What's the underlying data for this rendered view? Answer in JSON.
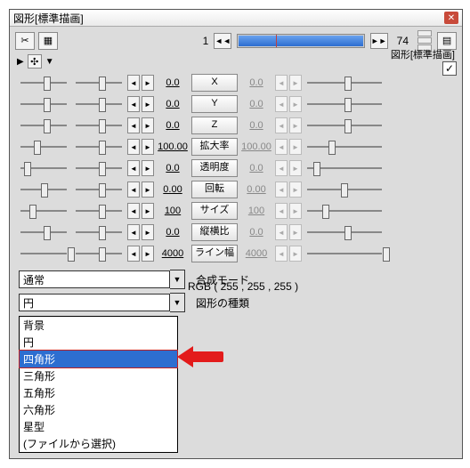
{
  "title": "図形[標準描画]",
  "frame": {
    "current": "1",
    "total": "74"
  },
  "right_label": "図形[標準描画]",
  "checked": "✓",
  "arrows": {
    "left": "◄",
    "right": "►",
    "skipfirst": "◄◄",
    "skiplast": "►►",
    "tri_right": "▶",
    "tri_down": "▼",
    "combo_down": "▼"
  },
  "params": [
    {
      "name": "x",
      "val": "0.0",
      "label": "X",
      "val2": "0.0"
    },
    {
      "name": "y",
      "val": "0.0",
      "label": "Y",
      "val2": "0.0"
    },
    {
      "name": "z",
      "val": "0.0",
      "label": "Z",
      "val2": "0.0"
    },
    {
      "name": "scale",
      "val": "100.00",
      "label": "拡大率",
      "val2": "100.00"
    },
    {
      "name": "alpha",
      "val": "0.0",
      "label": "透明度",
      "val2": "0.0"
    },
    {
      "name": "rot",
      "val": "0.00",
      "label": "回転",
      "val2": "0.00"
    },
    {
      "name": "size",
      "val": "100",
      "label": "サイズ",
      "val2": "100"
    },
    {
      "name": "ratio",
      "val": "0.0",
      "label": "縦横比",
      "val2": "0.0"
    },
    {
      "name": "line",
      "val": "4000",
      "label": "ライン幅",
      "val2": "4000"
    }
  ],
  "thumbs": [
    50,
    50,
    50,
    30,
    10,
    45,
    22,
    50,
    99
  ],
  "bottom": {
    "blend": {
      "value": "通常",
      "label": "合成モード"
    },
    "shape": {
      "value": "円",
      "label": "図形の種類"
    },
    "rgb": "RGB ( 255 , 255 , 255 )"
  },
  "dropdown": [
    "背景",
    "円",
    "四角形",
    "三角形",
    "五角形",
    "六角形",
    "星型",
    "(ファイルから選択)"
  ],
  "dropdown_selected": 2,
  "icons": {
    "cut": "✂",
    "img": "▦",
    "cursor": "✣"
  }
}
